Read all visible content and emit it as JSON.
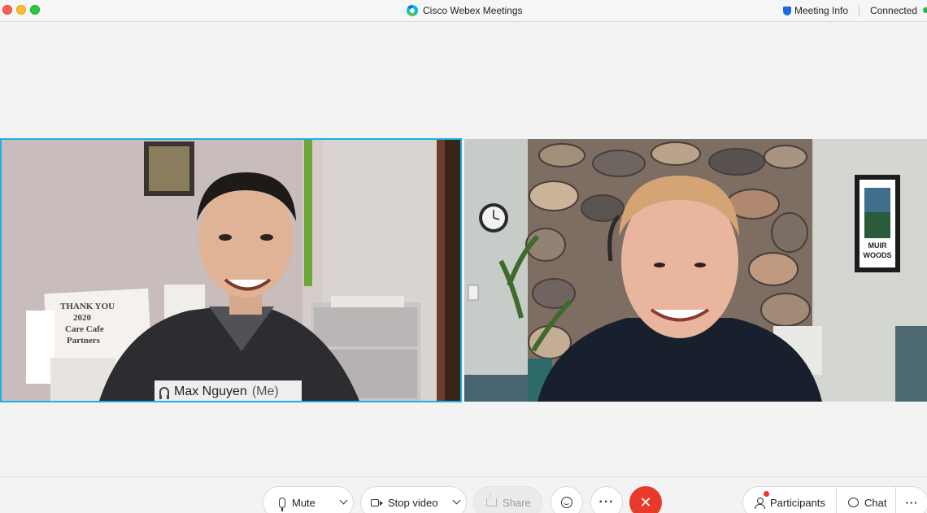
{
  "window": {
    "title": "Cisco Webex Meetings",
    "meeting_info_label": "Meeting Info",
    "status_label": "Connected"
  },
  "participants": [
    {
      "name": "Max Nguyen",
      "suffix": "(Me)",
      "active_speaker": true
    },
    {
      "name": "",
      "active_speaker": false
    }
  ],
  "scene": {
    "left_sign_lines": [
      "THANK YOU",
      "2020",
      "Care Cafe",
      "Partners"
    ],
    "poster_text": [
      "MUIR",
      "WOODS"
    ]
  },
  "toolbar": {
    "mute_label": "Mute",
    "video_label": "Stop video",
    "share_label": "Share",
    "more_glyph": "···",
    "leave_glyph": "✕",
    "participants_label": "Participants",
    "chat_label": "Chat",
    "overflow_glyph": "···"
  },
  "colors": {
    "active_border": "#18b0e6",
    "leave_red": "#e8392b",
    "connected_green": "#2bb24c"
  }
}
